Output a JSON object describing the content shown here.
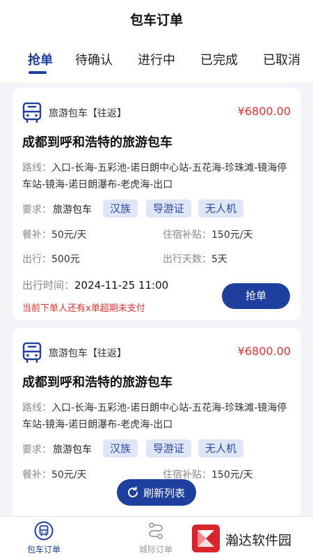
{
  "header": {
    "title": "包车订单"
  },
  "tabs": [
    {
      "label": "抢单"
    },
    {
      "label": "待确认"
    },
    {
      "label": "进行中"
    },
    {
      "label": "已完成"
    },
    {
      "label": "已取消"
    }
  ],
  "orders": [
    {
      "type": "旅游包车【往返】",
      "price": "¥6800.00",
      "title": "成都到呼和浩特的旅游包车",
      "route_label": "路线：",
      "route": "入口-长海-五彩池-诺日朗中心站-五花海-珍珠滩-镜海停车站-镜海-诺日朗瀑布-老虎海-出口",
      "req_label": "要求：",
      "req_text": "旅游包车",
      "tags": [
        "汉族",
        "导游证",
        "无人机"
      ],
      "meal_label": "餐补：",
      "meal_value": "50元/天",
      "lodging_label": "住宿补贴：",
      "lodging_value": "150元/天",
      "trip_label": "出行：",
      "trip_value": "500元",
      "days_label": "出行天数：",
      "days_value": "5天",
      "time_label": "出行时间：",
      "time_value": "2024-11-25 11:00",
      "warning": "当前下单人还有x单超期未支付",
      "grab_label": "抢单"
    },
    {
      "type": "旅游包车【往返】",
      "price": "¥6800.00",
      "title": "成都到呼和浩特的旅游包车",
      "route_label": "路线：",
      "route": "入口-长海-五彩池-诺日朗中心站-五花海-珍珠滩-镜海停车站-镜海-诺日朗瀑布-老虎海-出口",
      "req_label": "要求：",
      "req_text": "旅游包车",
      "tags": [
        "汉族",
        "导游证",
        "无人机"
      ],
      "meal_label": "餐补：",
      "meal_value": "50元/天",
      "lodging_label": "住宿补贴：",
      "lodging_value": "150元/天"
    }
  ],
  "refresh": {
    "label": "刷新列表",
    "icon": "refresh-icon"
  },
  "bottom_nav": [
    {
      "label": "包车订单",
      "icon": "bus-icon"
    },
    {
      "label": "城际订单",
      "icon": "route-icon"
    }
  ],
  "watermark": {
    "text": "瀚达软件园"
  },
  "colors": {
    "accent": "#1f3f9e",
    "price": "#e8322f",
    "tag_bg": "#dfe6f6"
  }
}
